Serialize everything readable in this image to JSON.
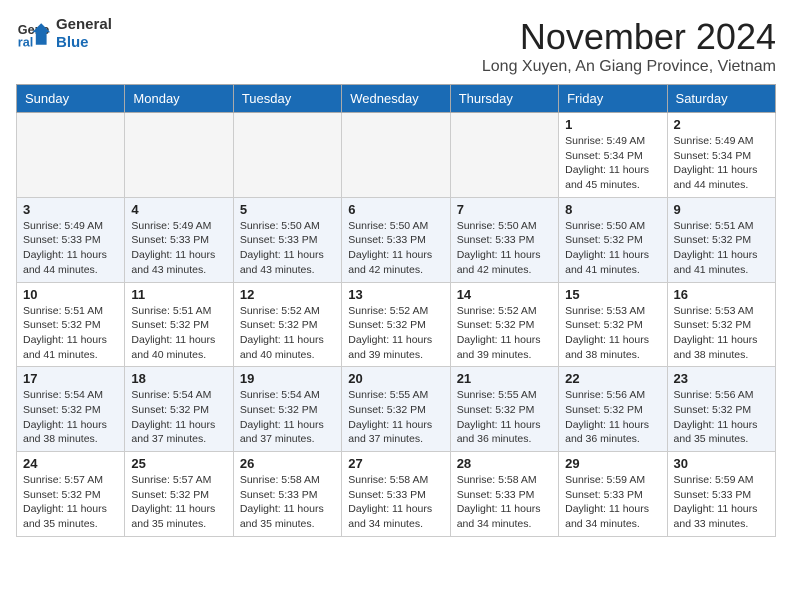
{
  "logo": {
    "line1": "General",
    "line2": "Blue"
  },
  "title": "November 2024",
  "location": "Long Xuyen, An Giang Province, Vietnam",
  "days_of_week": [
    "Sunday",
    "Monday",
    "Tuesday",
    "Wednesday",
    "Thursday",
    "Friday",
    "Saturday"
  ],
  "weeks": [
    [
      {
        "day": "",
        "info": ""
      },
      {
        "day": "",
        "info": ""
      },
      {
        "day": "",
        "info": ""
      },
      {
        "day": "",
        "info": ""
      },
      {
        "day": "",
        "info": ""
      },
      {
        "day": "1",
        "info": "Sunrise: 5:49 AM\nSunset: 5:34 PM\nDaylight: 11 hours and 45 minutes."
      },
      {
        "day": "2",
        "info": "Sunrise: 5:49 AM\nSunset: 5:34 PM\nDaylight: 11 hours and 44 minutes."
      }
    ],
    [
      {
        "day": "3",
        "info": "Sunrise: 5:49 AM\nSunset: 5:33 PM\nDaylight: 11 hours and 44 minutes."
      },
      {
        "day": "4",
        "info": "Sunrise: 5:49 AM\nSunset: 5:33 PM\nDaylight: 11 hours and 43 minutes."
      },
      {
        "day": "5",
        "info": "Sunrise: 5:50 AM\nSunset: 5:33 PM\nDaylight: 11 hours and 43 minutes."
      },
      {
        "day": "6",
        "info": "Sunrise: 5:50 AM\nSunset: 5:33 PM\nDaylight: 11 hours and 42 minutes."
      },
      {
        "day": "7",
        "info": "Sunrise: 5:50 AM\nSunset: 5:33 PM\nDaylight: 11 hours and 42 minutes."
      },
      {
        "day": "8",
        "info": "Sunrise: 5:50 AM\nSunset: 5:32 PM\nDaylight: 11 hours and 41 minutes."
      },
      {
        "day": "9",
        "info": "Sunrise: 5:51 AM\nSunset: 5:32 PM\nDaylight: 11 hours and 41 minutes."
      }
    ],
    [
      {
        "day": "10",
        "info": "Sunrise: 5:51 AM\nSunset: 5:32 PM\nDaylight: 11 hours and 41 minutes."
      },
      {
        "day": "11",
        "info": "Sunrise: 5:51 AM\nSunset: 5:32 PM\nDaylight: 11 hours and 40 minutes."
      },
      {
        "day": "12",
        "info": "Sunrise: 5:52 AM\nSunset: 5:32 PM\nDaylight: 11 hours and 40 minutes."
      },
      {
        "day": "13",
        "info": "Sunrise: 5:52 AM\nSunset: 5:32 PM\nDaylight: 11 hours and 39 minutes."
      },
      {
        "day": "14",
        "info": "Sunrise: 5:52 AM\nSunset: 5:32 PM\nDaylight: 11 hours and 39 minutes."
      },
      {
        "day": "15",
        "info": "Sunrise: 5:53 AM\nSunset: 5:32 PM\nDaylight: 11 hours and 38 minutes."
      },
      {
        "day": "16",
        "info": "Sunrise: 5:53 AM\nSunset: 5:32 PM\nDaylight: 11 hours and 38 minutes."
      }
    ],
    [
      {
        "day": "17",
        "info": "Sunrise: 5:54 AM\nSunset: 5:32 PM\nDaylight: 11 hours and 38 minutes."
      },
      {
        "day": "18",
        "info": "Sunrise: 5:54 AM\nSunset: 5:32 PM\nDaylight: 11 hours and 37 minutes."
      },
      {
        "day": "19",
        "info": "Sunrise: 5:54 AM\nSunset: 5:32 PM\nDaylight: 11 hours and 37 minutes."
      },
      {
        "day": "20",
        "info": "Sunrise: 5:55 AM\nSunset: 5:32 PM\nDaylight: 11 hours and 37 minutes."
      },
      {
        "day": "21",
        "info": "Sunrise: 5:55 AM\nSunset: 5:32 PM\nDaylight: 11 hours and 36 minutes."
      },
      {
        "day": "22",
        "info": "Sunrise: 5:56 AM\nSunset: 5:32 PM\nDaylight: 11 hours and 36 minutes."
      },
      {
        "day": "23",
        "info": "Sunrise: 5:56 AM\nSunset: 5:32 PM\nDaylight: 11 hours and 35 minutes."
      }
    ],
    [
      {
        "day": "24",
        "info": "Sunrise: 5:57 AM\nSunset: 5:32 PM\nDaylight: 11 hours and 35 minutes."
      },
      {
        "day": "25",
        "info": "Sunrise: 5:57 AM\nSunset: 5:32 PM\nDaylight: 11 hours and 35 minutes."
      },
      {
        "day": "26",
        "info": "Sunrise: 5:58 AM\nSunset: 5:33 PM\nDaylight: 11 hours and 35 minutes."
      },
      {
        "day": "27",
        "info": "Sunrise: 5:58 AM\nSunset: 5:33 PM\nDaylight: 11 hours and 34 minutes."
      },
      {
        "day": "28",
        "info": "Sunrise: 5:58 AM\nSunset: 5:33 PM\nDaylight: 11 hours and 34 minutes."
      },
      {
        "day": "29",
        "info": "Sunrise: 5:59 AM\nSunset: 5:33 PM\nDaylight: 11 hours and 34 minutes."
      },
      {
        "day": "30",
        "info": "Sunrise: 5:59 AM\nSunset: 5:33 PM\nDaylight: 11 hours and 33 minutes."
      }
    ]
  ]
}
